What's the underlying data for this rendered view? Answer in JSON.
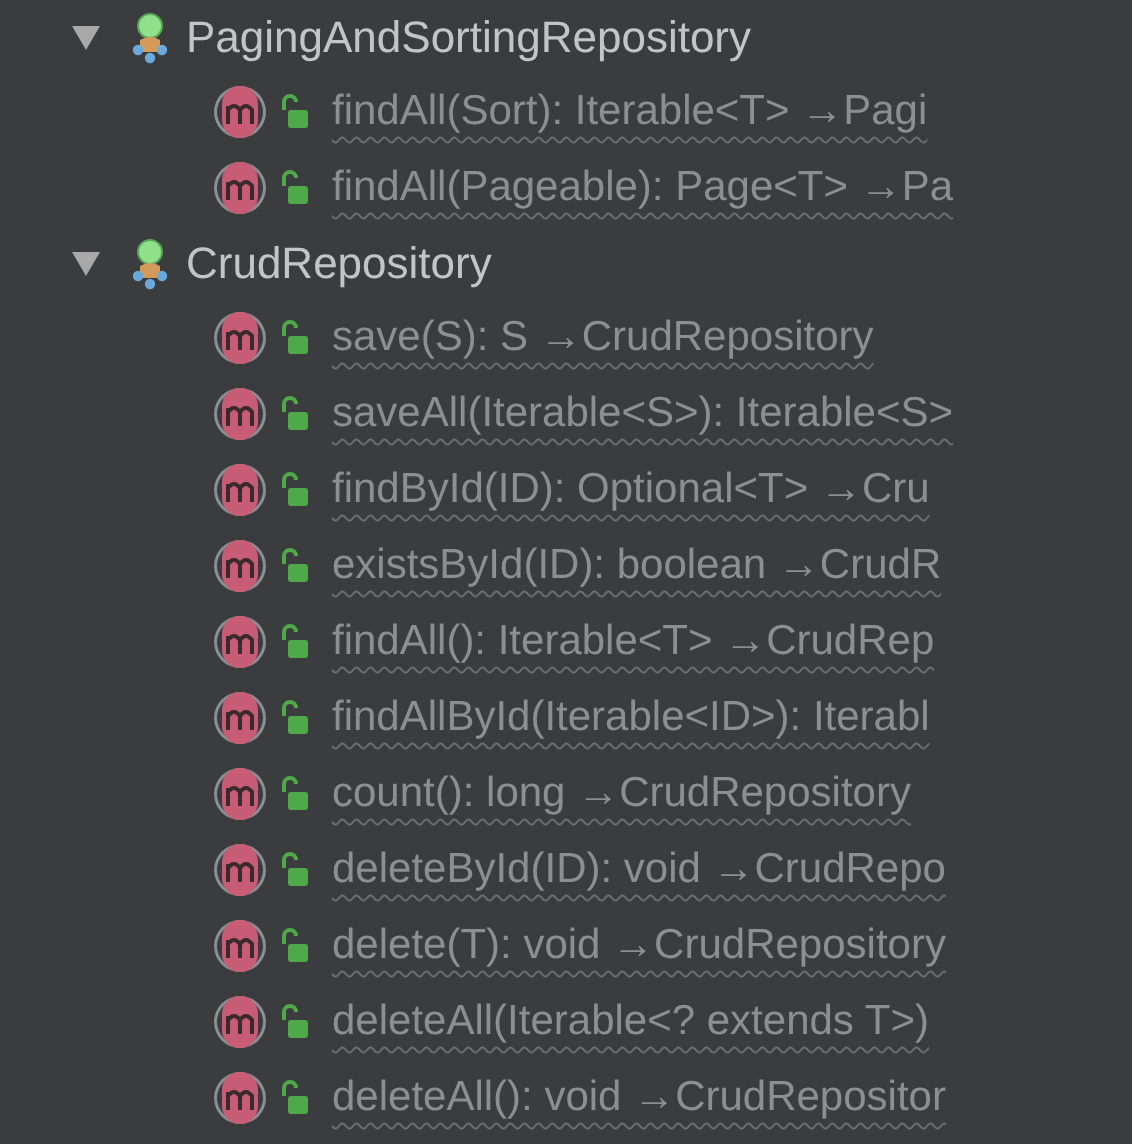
{
  "groups": [
    {
      "name": "PagingAndSortingRepository",
      "expanded": true,
      "children": [
        {
          "signature": "findAll(Sort): Iterable<T> →Pagi"
        },
        {
          "signature": "findAll(Pageable): Page<T> →Pa"
        }
      ]
    },
    {
      "name": "CrudRepository",
      "expanded": true,
      "children": [
        {
          "signature": "save(S): S →CrudRepository"
        },
        {
          "signature": "saveAll(Iterable<S>): Iterable<S>"
        },
        {
          "signature": "findById(ID): Optional<T> →Cru"
        },
        {
          "signature": "existsById(ID): boolean →CrudR"
        },
        {
          "signature": "findAll(): Iterable<T> →CrudRep"
        },
        {
          "signature": "findAllById(Iterable<ID>): Iterabl"
        },
        {
          "signature": "count(): long →CrudRepository"
        },
        {
          "signature": "deleteById(ID): void →CrudRepo"
        },
        {
          "signature": "delete(T): void →CrudRepository"
        },
        {
          "signature": "deleteAll(Iterable<? extends T>)"
        },
        {
          "signature": "deleteAll(): void →CrudRepositor"
        }
      ]
    }
  ]
}
